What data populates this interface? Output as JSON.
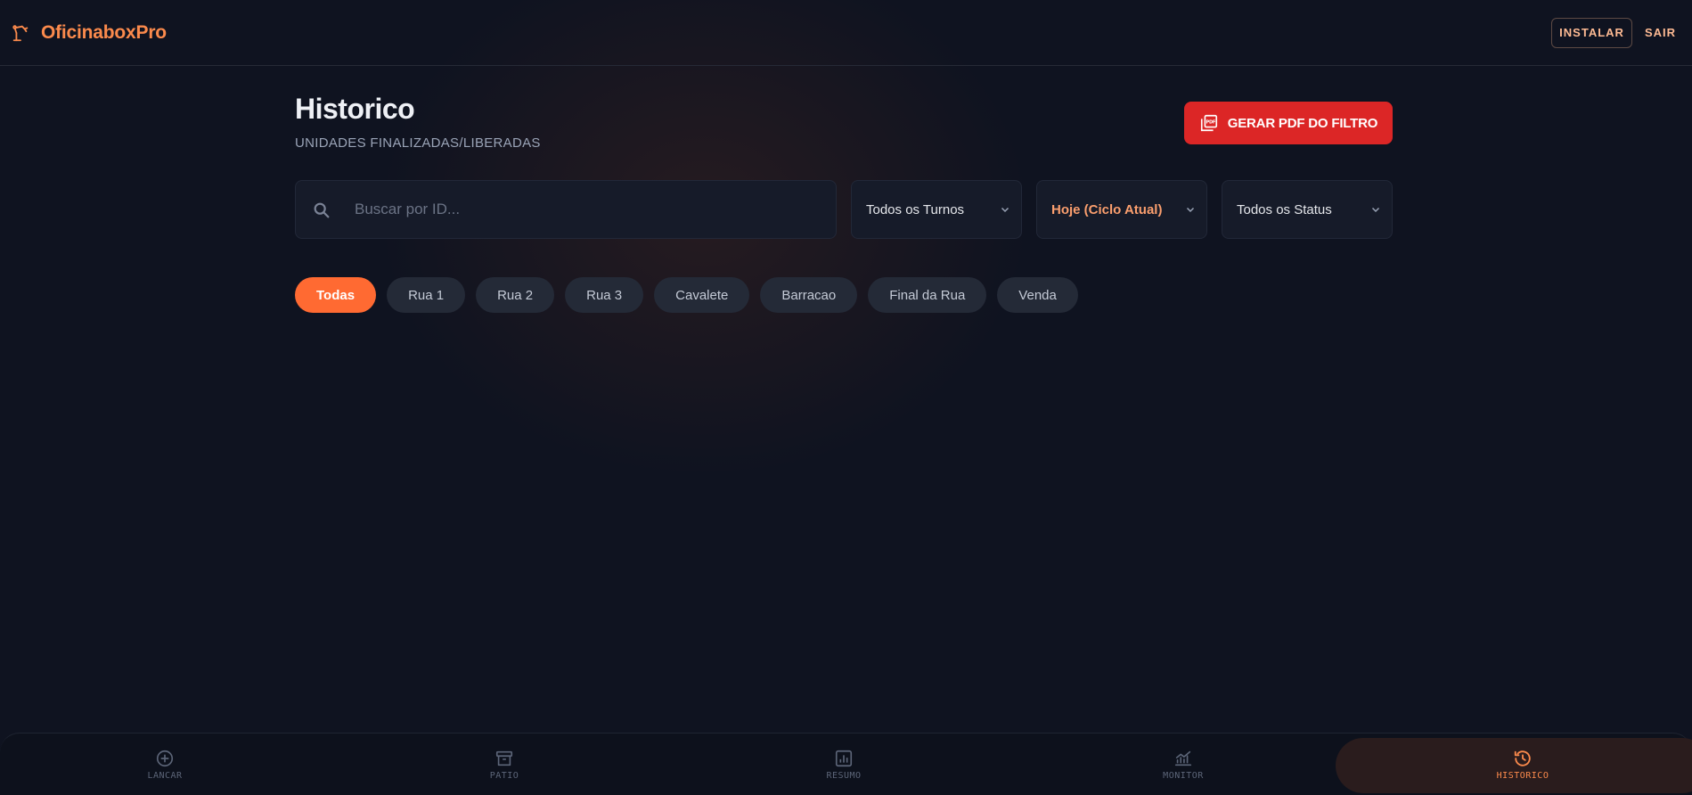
{
  "header": {
    "brand": "OficinaboxPro",
    "install_label": "INSTALAR",
    "logout_label": "SAIR"
  },
  "page": {
    "title": "Historico",
    "subtitle": "UNIDADES FINALIZADAS/LIBERADAS",
    "pdf_button_label": "GERAR PDF DO FILTRO"
  },
  "filters": {
    "search_placeholder": "Buscar por ID...",
    "search_value": "",
    "shift_select": "Todos os Turnos",
    "period_select": "Hoje (Ciclo Atual)",
    "status_select": "Todos os Status"
  },
  "chips": [
    {
      "label": "Todas",
      "active": true
    },
    {
      "label": "Rua 1",
      "active": false
    },
    {
      "label": "Rua 2",
      "active": false
    },
    {
      "label": "Rua 3",
      "active": false
    },
    {
      "label": "Cavalete",
      "active": false
    },
    {
      "label": "Barracao",
      "active": false
    },
    {
      "label": "Final da Rua",
      "active": false
    },
    {
      "label": "Venda",
      "active": false
    }
  ],
  "nav": [
    {
      "label": "LANCAR",
      "icon": "plus-circle-icon",
      "active": false
    },
    {
      "label": "PATIO",
      "icon": "archive-icon",
      "active": false
    },
    {
      "label": "RESUMO",
      "icon": "bar-chart-icon",
      "active": false
    },
    {
      "label": "MONITOR",
      "icon": "trend-chart-icon",
      "active": false
    },
    {
      "label": "HISTORICO",
      "icon": "history-icon",
      "active": true
    }
  ],
  "colors": {
    "accent": "#ff6a32",
    "pdf_button": "#dc2626",
    "background": "#0f1320"
  }
}
